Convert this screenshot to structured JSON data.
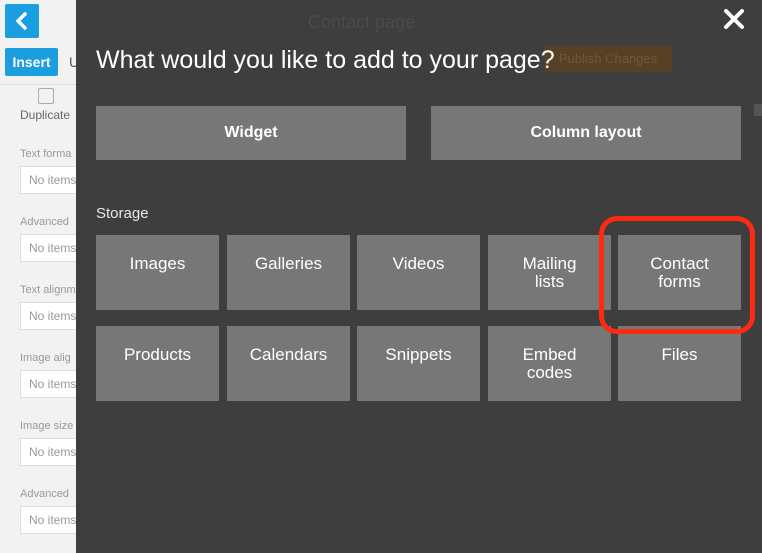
{
  "editor": {
    "insert_label": "Insert",
    "undo_label": "U",
    "duplicate_label": "Duplicate",
    "fields": [
      {
        "label": "Text forma",
        "value": "No items selected"
      },
      {
        "label": "Advanced",
        "value": "No items selected"
      },
      {
        "label": "Text alignm",
        "value": "No items selected"
      },
      {
        "label": "Image alig",
        "value": "No items selected"
      },
      {
        "label": "Image size",
        "value": "No items selected"
      },
      {
        "label": "Advanced",
        "value": "No items selected"
      }
    ],
    "page_title": "Contact page",
    "publish_label": "Publish Changes"
  },
  "modal": {
    "heading": "What would you like to add to your page?",
    "widget_label": "Widget",
    "column_layout_label": "Column layout",
    "storage_label": "Storage",
    "tiles": [
      {
        "label": "Images"
      },
      {
        "label": "Galleries"
      },
      {
        "label": "Videos"
      },
      {
        "label": "Mailing lists"
      },
      {
        "label": "Contact forms"
      },
      {
        "label": "Products"
      },
      {
        "label": "Calendars"
      },
      {
        "label": "Snippets"
      },
      {
        "label": "Embed codes"
      },
      {
        "label": "Files"
      }
    ],
    "highlighted_tile": "Contact forms"
  },
  "icons": {
    "back": "chevron-left-icon",
    "close": "close-icon",
    "duplicate": "duplicate-icon"
  },
  "colors": {
    "accent_blue": "#1a9ee0",
    "modal_bg": "#3e3e3e",
    "tile_bg": "#777777",
    "highlight": "#ff2a12"
  }
}
